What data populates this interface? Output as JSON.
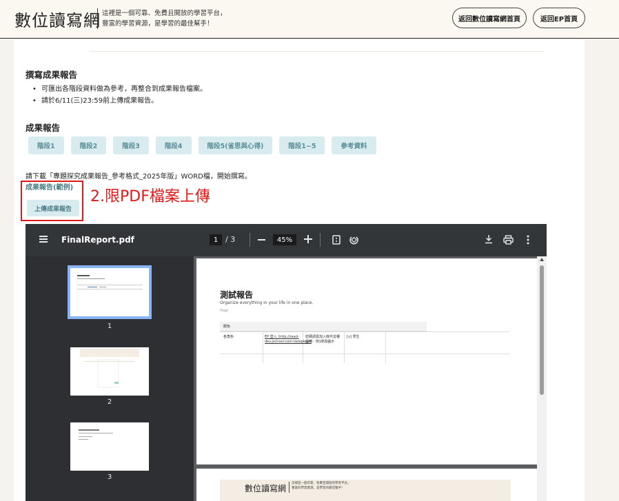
{
  "header": {
    "logo": "數位讀寫網",
    "slogan_line1": "這裡是一個可靠、免費且開放的學習平台，",
    "slogan_line2": "豐富的學習資源，是學習的最佳幫手！",
    "btn_home": "返回數位讀寫網首頁",
    "btn_ep": "返回EP首頁"
  },
  "section_write": {
    "title": "撰寫成果報告",
    "bullets": [
      "可匯出各階段資料做為參考，再整合到成果報告檔案。",
      "請於6/11(三)23:59前上傳成果報告。"
    ]
  },
  "section_report": {
    "title": "成果報告",
    "phases": [
      "階段1",
      "階段2",
      "階段3",
      "階段4",
      "階段5(省思與心得)",
      "階段1~5",
      "參考資料"
    ],
    "download_text": "請下載「專題探究成果報告_參考格式_2025年版」WORD檔，開始撰寫。",
    "example_link": "成果報告(範例)",
    "upload_label": "上傳成果報告",
    "annotation": "2.限PDF檔案上傳"
  },
  "pdf_viewer": {
    "file_name": "FinalReport.pdf",
    "current_page": "1",
    "total_pages": "/ 3",
    "zoom": "45%",
    "thumb_numbers": [
      "1",
      "2",
      "3"
    ],
    "page1": {
      "title": "測試報告",
      "subtitle": "Organize everything in your life in one place.",
      "page_label": "Page",
      "table_header": "觀色",
      "row_label": "各角色",
      "cell_link": "EP 登入 (http://read-dev.jschool.com.tw/eplogin",
      "cell_note": "密碼請需加入條件並種設備：例)搜尋圖示",
      "cell_student": "[v] 學生"
    },
    "page2": {
      "logo": "數位讀寫網",
      "slogan_line1": "這裡是一個可靠、免費且開放的學習平台，",
      "slogan_line2": "豐富的學習資源，是學習的最佳幫手！"
    }
  },
  "colors": {
    "accent_teal": "#4a7d87",
    "phase_bg": "#d8ebee",
    "annotation_red": "#e21818"
  }
}
